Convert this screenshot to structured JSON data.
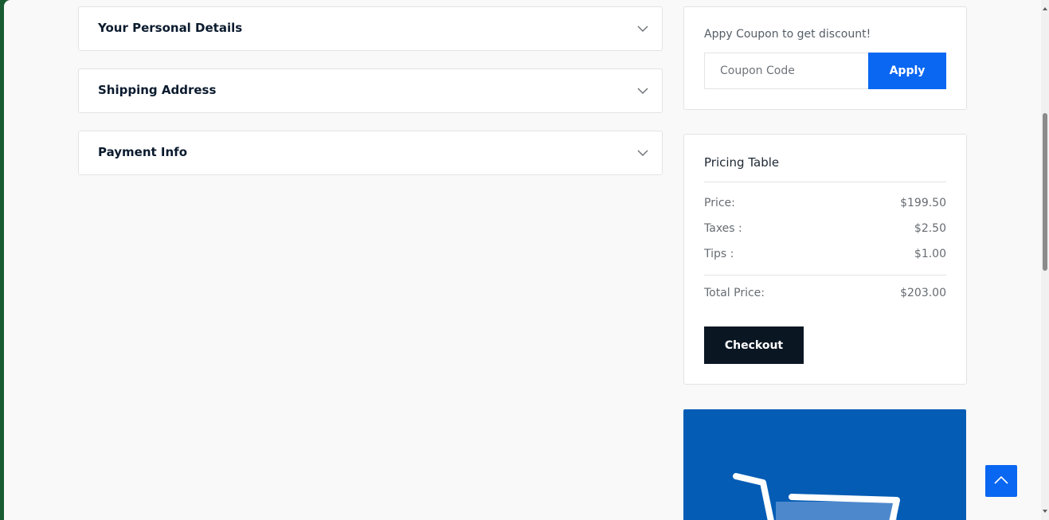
{
  "accordions": [
    {
      "label": "Your Personal Details"
    },
    {
      "label": "Shipping Address"
    },
    {
      "label": "Payment Info"
    }
  ],
  "coupon": {
    "title": "Appy Coupon to get discount!",
    "placeholder": "Coupon Code",
    "apply_label": "Apply"
  },
  "pricing": {
    "title": "Pricing Table",
    "rows": [
      {
        "label": "Price:",
        "value": "$199.50"
      },
      {
        "label": "Taxes :",
        "value": "$2.50"
      },
      {
        "label": "Tips :",
        "value": "$1.00"
      }
    ],
    "total": {
      "label": "Total Price:",
      "value": "$203.00"
    },
    "checkout_label": "Checkout"
  },
  "colors": {
    "primary": "#0a67f2",
    "dark": "#0b1623",
    "banner": "#045cb5"
  },
  "icons": {
    "accordion": "chevron-down-icon",
    "scroll_top": "chevron-up-icon",
    "banner": "shopping-cart-icon"
  }
}
